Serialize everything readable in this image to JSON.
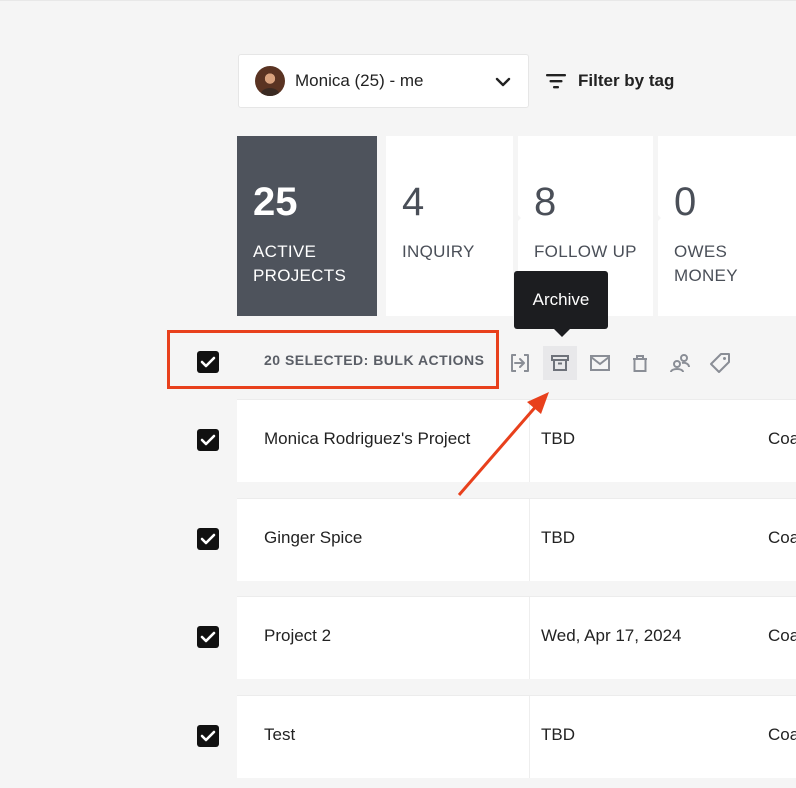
{
  "user_select": {
    "label": "Monica (25) - me"
  },
  "filter": {
    "label": "Filter by tag"
  },
  "stats": [
    {
      "count": "25",
      "label": "ACTIVE PROJECTS"
    },
    {
      "count": "4",
      "label": "INQUIRY"
    },
    {
      "count": "8",
      "label": "FOLLOW UP"
    },
    {
      "count": "0",
      "label": "OWES MONEY"
    }
  ],
  "tooltip": {
    "text": "Archive"
  },
  "bulk": {
    "label": "20 SELECTED: BULK ACTIONS"
  },
  "bulk_actions": [
    "move-icon",
    "archive-icon",
    "email-icon",
    "trash-icon",
    "assign-team-icon",
    "tag-icon"
  ],
  "rows": [
    {
      "name": "Monica Rodriguez's Project",
      "date": "TBD",
      "extra": "Coa"
    },
    {
      "name": "Ginger Spice",
      "date": "TBD",
      "extra": "Coa"
    },
    {
      "name": "Project 2",
      "date": "Wed, Apr 17, 2024",
      "extra": "Coa"
    },
    {
      "name": "Test",
      "date": "TBD",
      "extra": "Coa"
    }
  ],
  "colors": {
    "highlight": "#e8401c",
    "active_card": "#4e535c",
    "tooltip": "#1c1d20"
  }
}
